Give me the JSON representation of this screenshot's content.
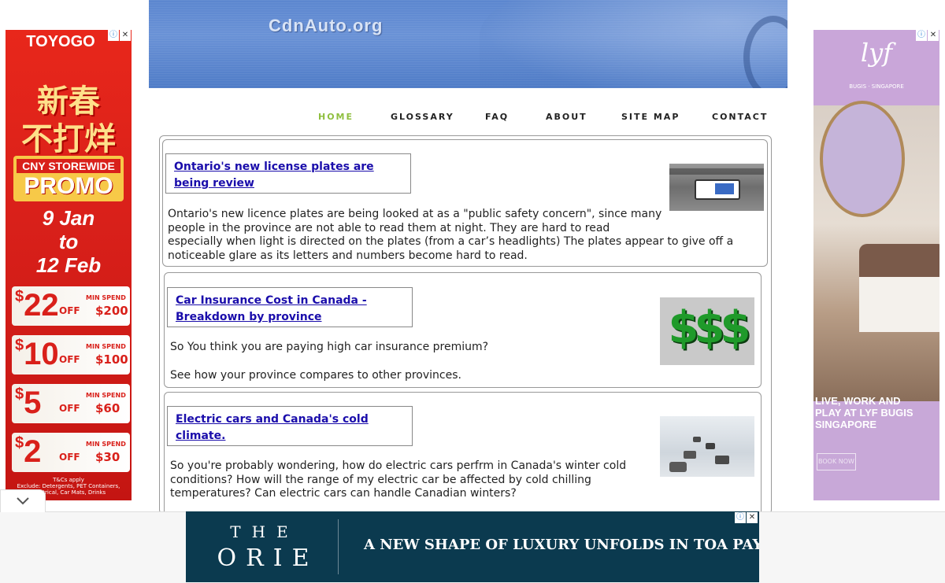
{
  "header": {
    "logo": "CdnAuto.org"
  },
  "nav": {
    "items": [
      {
        "label": "HOME",
        "active": true
      },
      {
        "label": "GLOSSARY"
      },
      {
        "label": "FAQ"
      },
      {
        "label": "ABOUT"
      },
      {
        "label": "SITE MAP"
      },
      {
        "label": "CONTACT"
      }
    ]
  },
  "articles": [
    {
      "title_line1": "Ontario's new license plates are",
      "title_line2": "being review",
      "body": [
        "Ontario's new licence plates are being looked at as a \"public safety concern\", since many",
        "people in the province are not able to read them at night.  They are hard to read",
        "especially when light is directed on the plates (from a car’s headlights) The plates appear to give off a",
        "noticeable glare as its letters and numbers become hard to read."
      ]
    },
    {
      "title_line1": "Car Insurance Cost in Canada -",
      "title_line2": "Breakdown by province",
      "body": [
        "So You think you are paying high car insurance premium?",
        "See how your province compares to other provinces."
      ],
      "thumb_text": "$$$"
    },
    {
      "title_line1": "Electric cars and Canada's cold",
      "title_line2": "climate.",
      "body": [
        "So you're probably wondering, how do electric cars perfrm in Canada's winter cold",
        "conditions? How will the range of my electric car be affected by cold chilling",
        "temperatures? Can electric cars can handle Canadian winters?"
      ]
    }
  ],
  "ads": {
    "left": {
      "brand": "TOYOGO",
      "chinese1": "新春",
      "chinese2": "不打烊",
      "banner": "CNY STOREWIDE",
      "promo": "PROMO",
      "dates1": "9 Jan",
      "dates2": "to",
      "dates3": "12 Feb",
      "offers": [
        {
          "amount": "22",
          "spend": "$200"
        },
        {
          "amount": "10",
          "spend": "$100"
        },
        {
          "amount": "5",
          "spend": "$60"
        },
        {
          "amount": "2",
          "spend": "$30"
        }
      ],
      "off_label": "OFF",
      "min_spend_label": "MIN SPEND",
      "dollar": "$",
      "tcs": "T&Cs apply",
      "exclude": "Exclude: Detergents, PET Containers, Electrical, Car Mats, Drinks"
    },
    "right": {
      "brand": "lyf",
      "location": "BUGIS · SINGAPORE",
      "tagline": "LIVE, WORK AND PLAY AT LYF BUGIS SINGAPORE",
      "cta": "BOOK NOW"
    },
    "bottom": {
      "brand_line1": "THE",
      "brand_line2": "ORIE",
      "headline": "A NEW SHAPE OF LUXURY UNFOLDS IN TOA PAYOH"
    },
    "adchoice_icon": "ⓘ",
    "close_icon": "✕"
  },
  "colors": {
    "nav_active": "#8fbf3f",
    "link": "#1a0dab",
    "ad_bottom_bg": "#0b3a4f"
  }
}
